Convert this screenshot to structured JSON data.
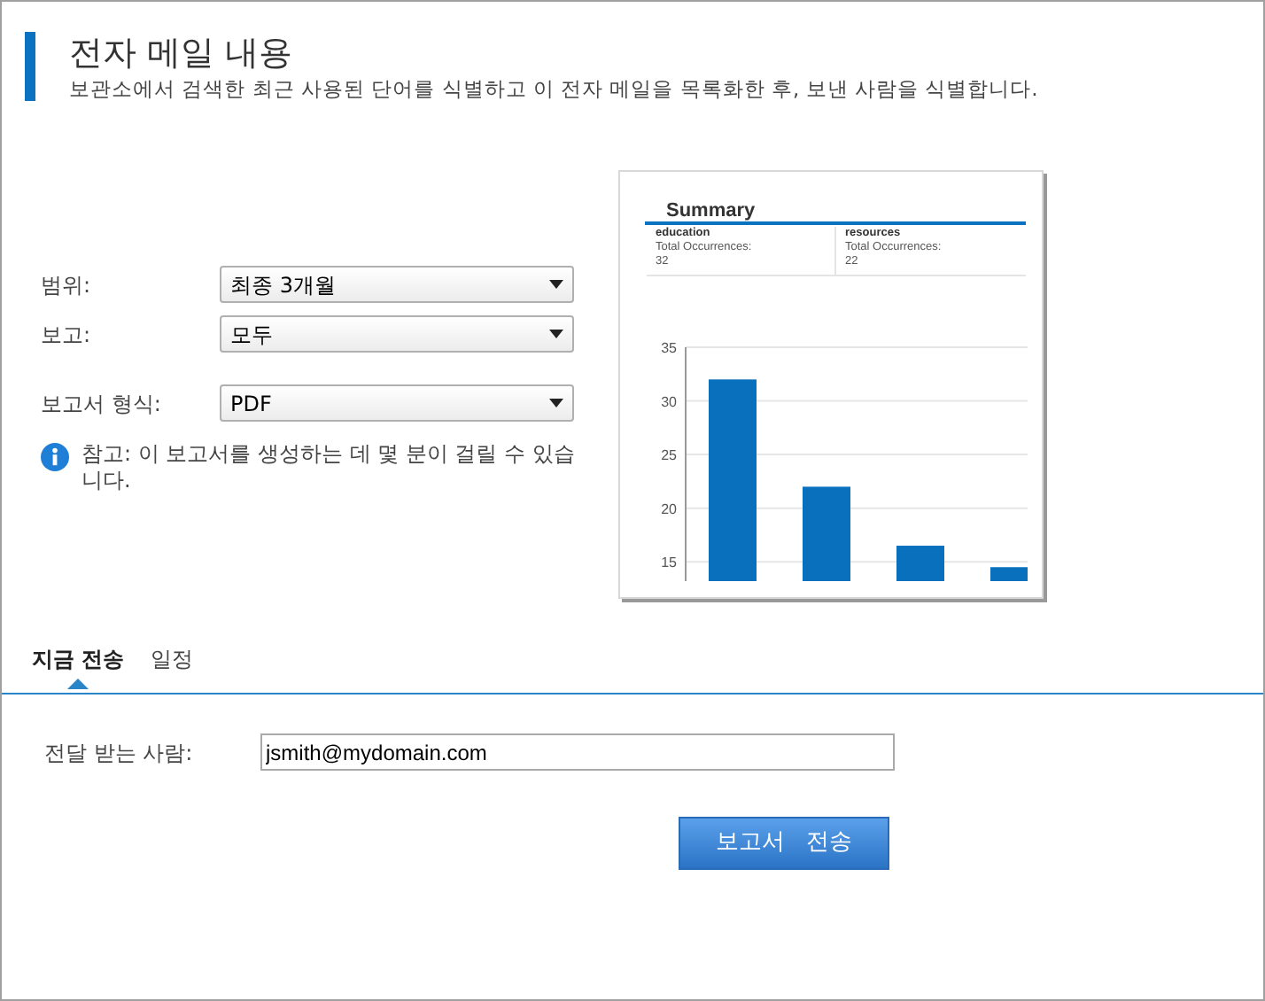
{
  "header": {
    "title": "전자 메일 내용",
    "subtitle": "보관소에서 검색한 최근 사용된 단어를 식별하고 이 전자 메일을 목록화한 후, 보낸 사람을 식별합니다."
  },
  "form": [
    {
      "label": "범위:",
      "value": "최종 3개월"
    },
    {
      "label": "보고:",
      "value": "모두"
    },
    {
      "label": "보고서 형식:",
      "value": "PDF"
    }
  ],
  "note": "참고: 이 보고서를 생성하는 데 몇 분이 걸릴 수 있습니다.",
  "preview": {
    "title": "Summary",
    "cards": [
      {
        "term": "education",
        "caption": "Total Occurrences:",
        "count": "32"
      },
      {
        "term": "resources",
        "caption": "Total Occurrences:",
        "count": "22"
      }
    ],
    "chart_data": {
      "type": "bar",
      "values": [
        32,
        22,
        16.5,
        14.5
      ],
      "ylim": [
        13.2,
        35
      ],
      "yticks": [
        15,
        20,
        25,
        30,
        35
      ],
      "grid": true
    }
  },
  "tabs": [
    {
      "label": "지금 전송",
      "selected": true
    },
    {
      "label": "일정",
      "selected": false
    }
  ],
  "recipient": {
    "label": "전달 받는 사람:",
    "value": "jsmith@mydomain.com"
  },
  "send_button": "보고서   전송"
}
